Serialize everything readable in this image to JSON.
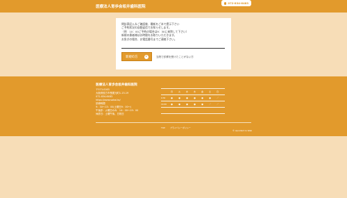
{
  "header": {
    "clinic_name": "医療法人育歩会坂井歯科医院",
    "phone": "072-834-6483"
  },
  "message": {
    "lines": [
      "問診表記入＆ご確認後、最新をご本で提示下さい",
      "ご予約状況の自動返信でお知らせします。",
      "（例　10：00ご予約の場合は9：30に来院して下さい）",
      "新規の患者様はお時間をお取りいただきます。",
      "お急ぎの場合、お電話番号までご連絡下さい。"
    ],
    "new_button_label": "新規の方",
    "new_button_note": "当院で診察を受けたことがない方"
  },
  "footer": {
    "clinic_name": "医療法人育歩会坂井歯科医院",
    "info_lines": [
      "〒573-0163",
      "大阪府枚方市長尾元町1-15-19",
      "072-834-6483",
      "https://www.sakai.to/",
      "診療時間",
      "9：30～13：00(土曜日9：00～)",
      "午後診：火曜日のみ　14：00～19：00",
      "休診日：土曜午後、日祝日"
    ],
    "schedule": {
      "days": [
        "月",
        "火",
        "水",
        "木",
        "金",
        "土",
        "日"
      ],
      "rows": [
        {
          "label": "",
          "marks": [
            "",
            "",
            "",
            "",
            "",
            "",
            ""
          ]
        },
        {
          "label": "9:30",
          "marks": [
            "●",
            "●",
            "●",
            "●",
            "●",
            "●",
            "／"
          ]
        },
        {
          "label": "14:00",
          "marks": [
            "●",
            "●",
            "●",
            "●",
            "●",
            "／",
            "／"
          ]
        },
        {
          "label": "",
          "marks": [
            "",
            "",
            "",
            "",
            "",
            "",
            ""
          ]
        }
      ]
    },
    "links": [
      "TOP",
      "プライバシーポリシー"
    ],
    "copyright": "© Apoident & Web"
  }
}
